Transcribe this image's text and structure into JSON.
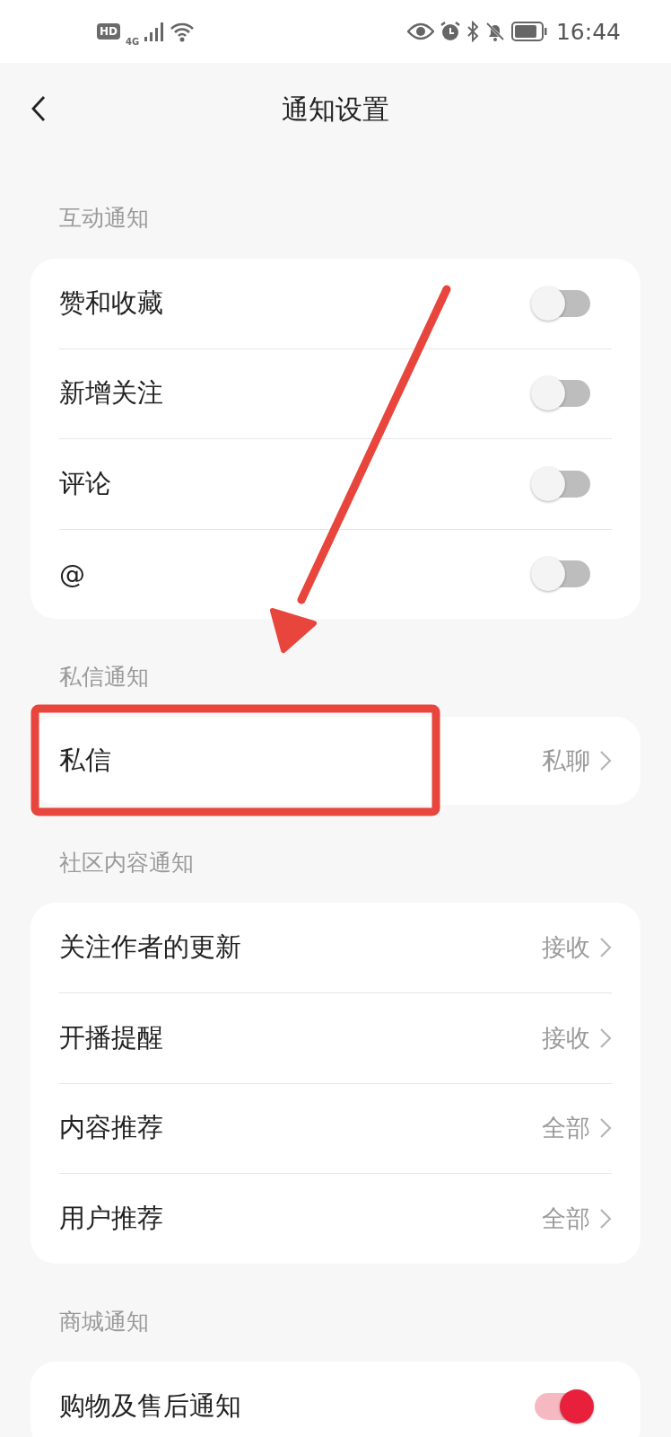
{
  "status_bar": {
    "hd": "HD",
    "network": "4G",
    "time": "16:44"
  },
  "header": {
    "title": "通知设置"
  },
  "sections": [
    {
      "label": "互动通知",
      "items": [
        {
          "kind": "toggle",
          "label": "赞和收藏",
          "on": false
        },
        {
          "kind": "toggle",
          "label": "新增关注",
          "on": false
        },
        {
          "kind": "toggle",
          "label": "评论",
          "on": false
        },
        {
          "kind": "toggle",
          "label": "@",
          "on": false
        }
      ]
    },
    {
      "label": "私信通知",
      "items": [
        {
          "kind": "link",
          "label": "私信",
          "value": "私聊"
        }
      ]
    },
    {
      "label": "社区内容通知",
      "items": [
        {
          "kind": "link",
          "label": "关注作者的更新",
          "value": "接收"
        },
        {
          "kind": "link",
          "label": "开播提醒",
          "value": "接收"
        },
        {
          "kind": "link",
          "label": "内容推荐",
          "value": "全部"
        },
        {
          "kind": "link",
          "label": "用户推荐",
          "value": "全部"
        }
      ]
    },
    {
      "label": "商城通知",
      "items": [
        {
          "kind": "toggle",
          "label": "购物及售后通知",
          "on": true
        }
      ]
    }
  ],
  "annotations": {
    "arrow": true,
    "highlight_box": true
  }
}
